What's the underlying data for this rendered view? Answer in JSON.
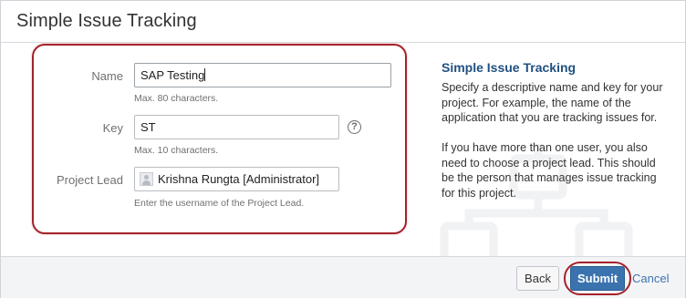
{
  "dialog": {
    "title": "Simple Issue Tracking"
  },
  "form": {
    "name": {
      "label": "Name",
      "value": "SAP Testing",
      "hint": "Max. 80 characters."
    },
    "key": {
      "label": "Key",
      "value": "ST",
      "hint": "Max. 10 characters.",
      "help_icon": "?"
    },
    "project_lead": {
      "label": "Project Lead",
      "value": "Krishna Rungta [Administrator]",
      "hint": "Enter the username of the Project Lead."
    }
  },
  "side_panel": {
    "title": "Simple Issue Tracking",
    "paragraph1_lines": [
      "Specify a descriptive name and key for your",
      "project. For example, the name of the",
      "application that you are tracking issues for."
    ],
    "paragraph2_lines": [
      "If you have more than one user, you also",
      "need to choose a project lead. This should",
      "be the person that manages issue tracking",
      "for this project."
    ]
  },
  "footer": {
    "back_label": "Back",
    "submit_label": "Submit",
    "cancel_label": "Cancel"
  },
  "colors": {
    "accent": "#3b73af",
    "link": "#205081",
    "annotation": "#a5222a"
  }
}
